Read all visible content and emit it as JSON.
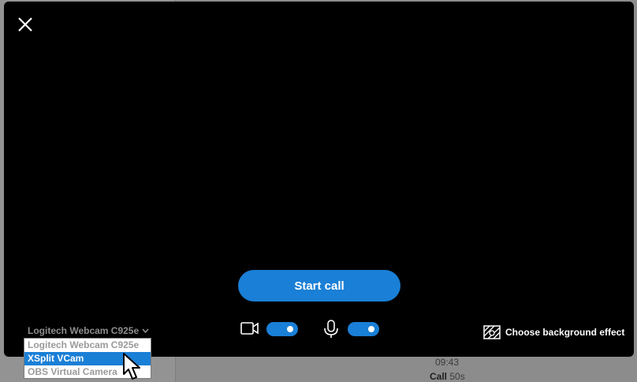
{
  "background": {
    "chat_time": "09:43",
    "chat_call_label": "Call",
    "chat_call_duration": "50s"
  },
  "modal": {
    "close_icon": "close-icon",
    "start_call_label": "Start call",
    "webcam": {
      "selected": "Logitech Webcam C925e",
      "options": [
        "Logitech Webcam C925e",
        "XSplit VCam",
        "OBS Virtual Camera"
      ],
      "highlighted_index": 1
    },
    "video_toggle_on": true,
    "mic_toggle_on": true,
    "background_effect_label": "Choose background effect"
  },
  "colors": {
    "accent": "#1a7fd6",
    "modal_bg": "#000000"
  }
}
